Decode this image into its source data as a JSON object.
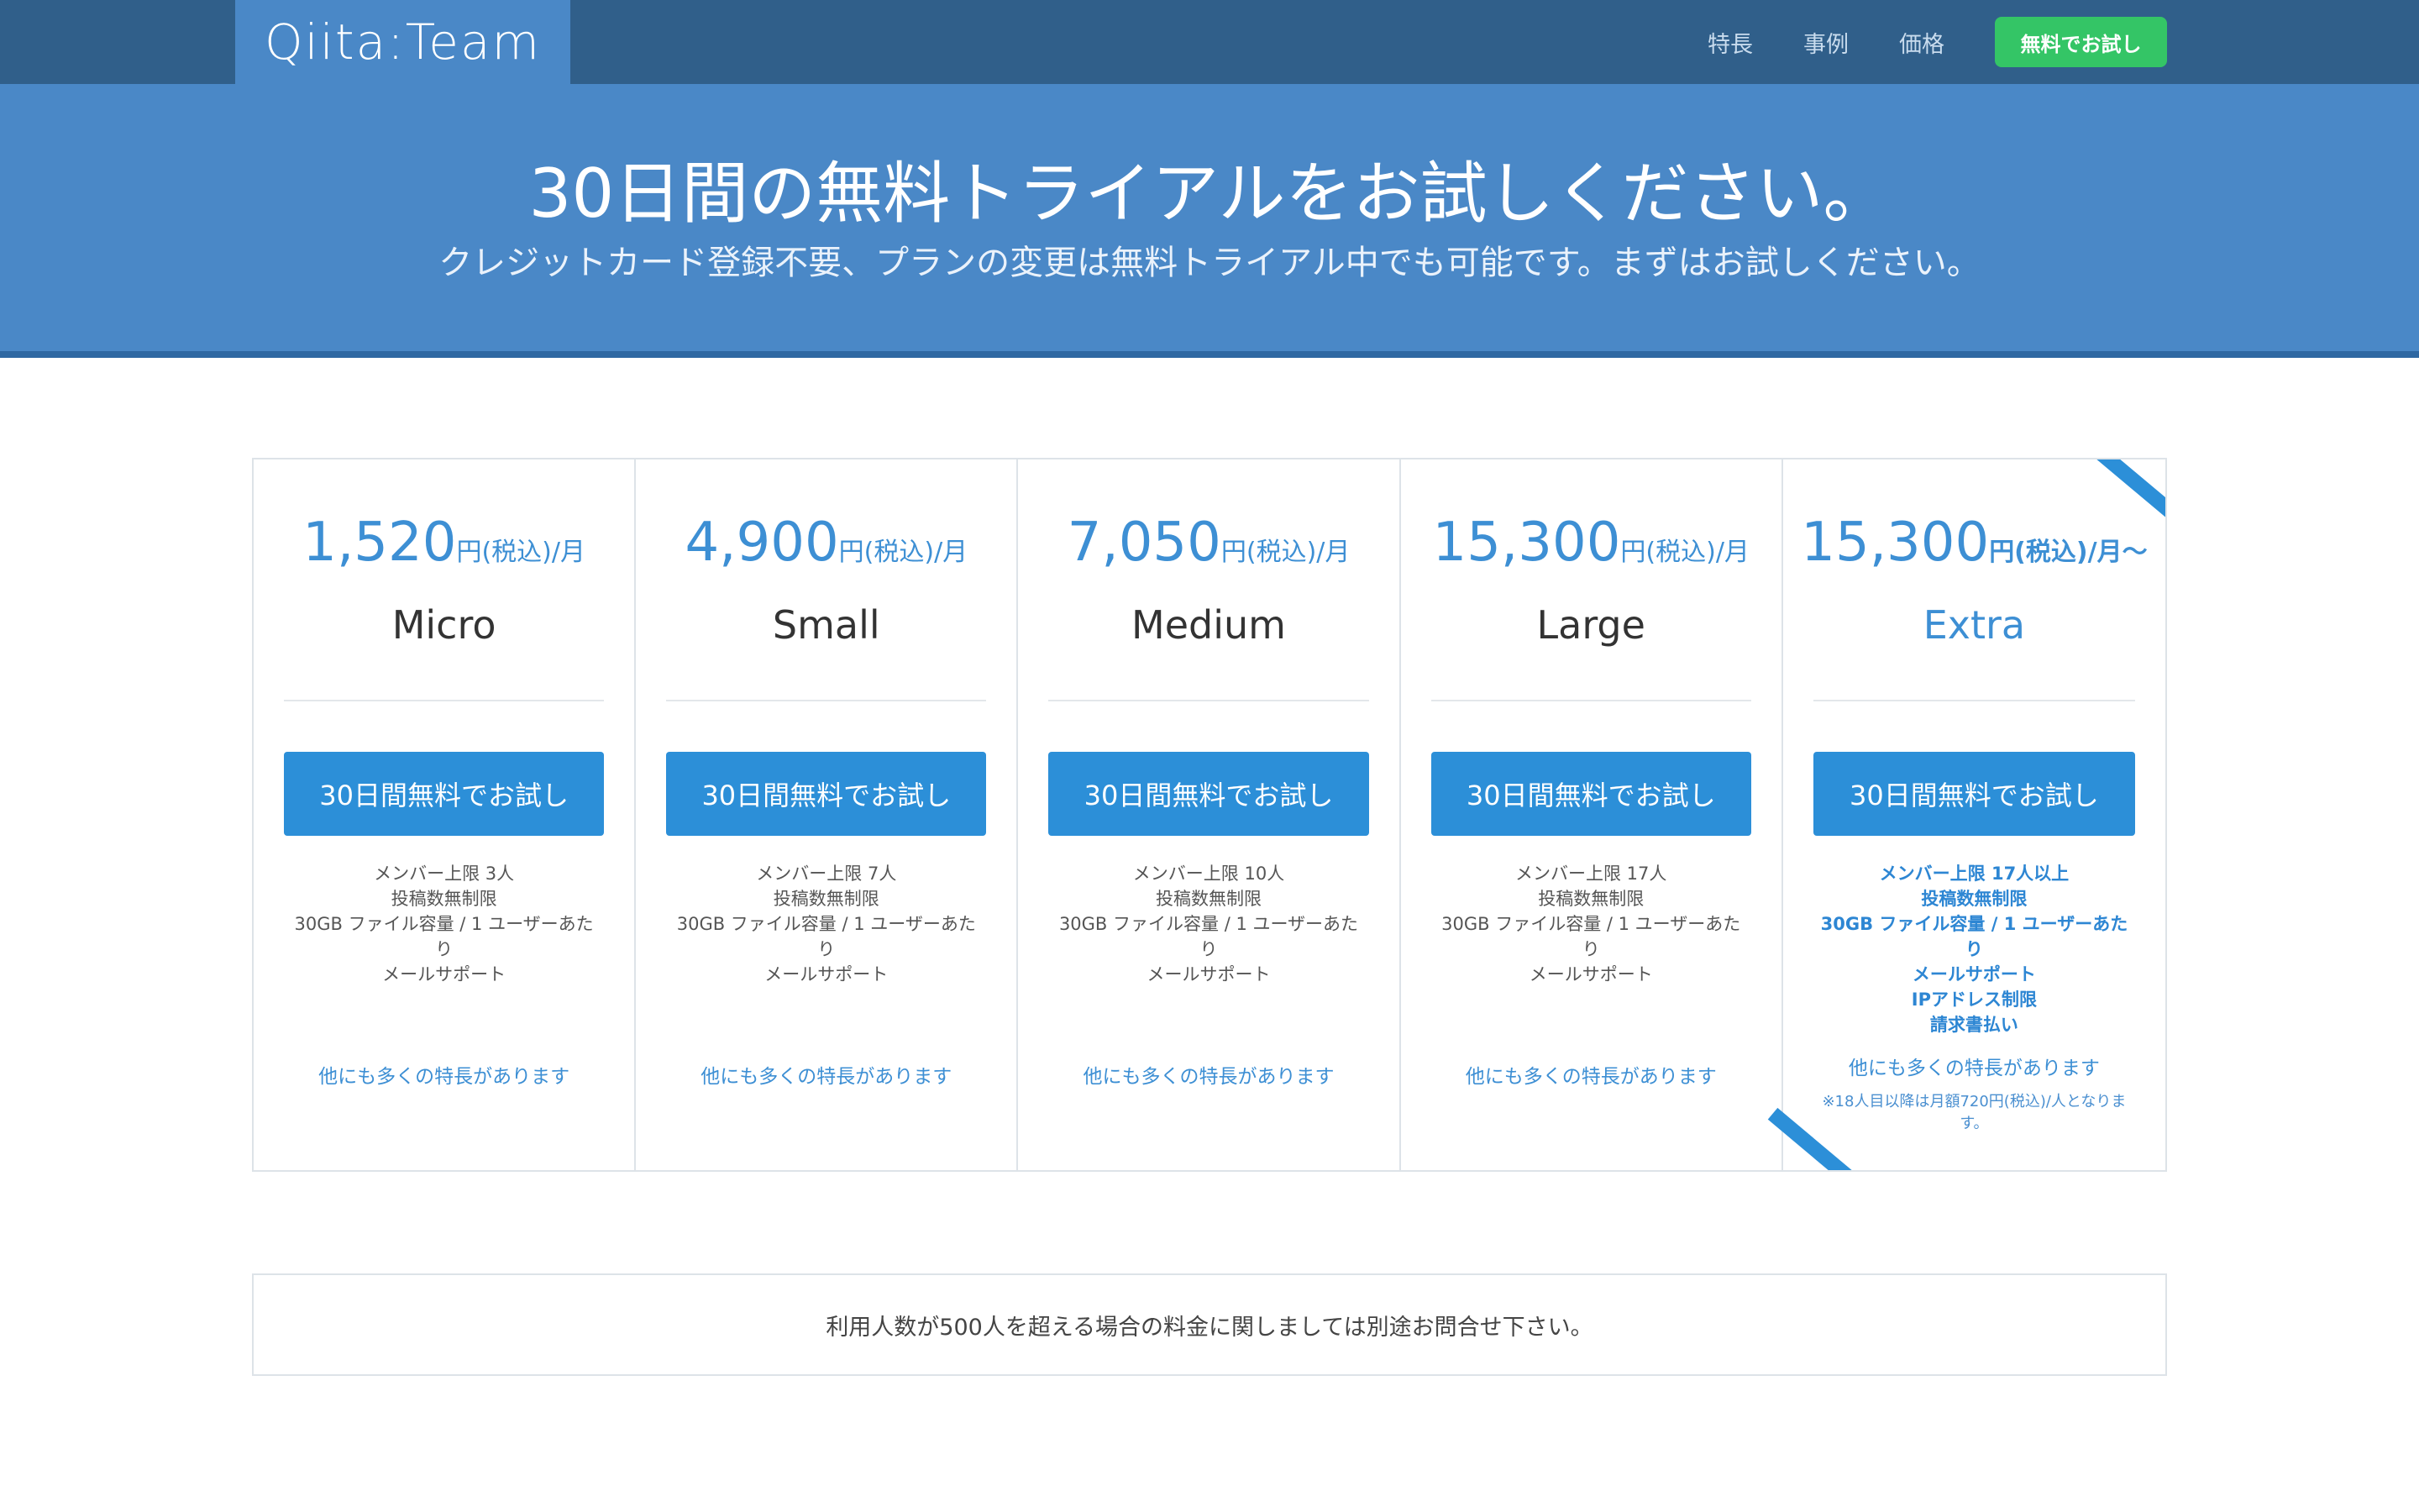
{
  "header": {
    "logo": "Qiita:Team",
    "nav": [
      {
        "label": "特長"
      },
      {
        "label": "事例"
      },
      {
        "label": "価格"
      }
    ],
    "cta_label": "無料でお試し"
  },
  "hero": {
    "title": "30日間の無料トライアルをお試しください。",
    "subtitle": "クレジットカード登録不要、プランの変更は無料トライアル中でも可能です。まずはお試しください。"
  },
  "plans": [
    {
      "price": "1,520",
      "unit": "円(税込)/月",
      "name": "Micro",
      "button": "30日間無料でお試し",
      "features": [
        "メンバー上限 3人",
        "投稿数無制限",
        "30GB ファイル容量 / 1 ユーザーあたり",
        "メールサポート"
      ],
      "more": "他にも多くの特長があります"
    },
    {
      "price": "4,900",
      "unit": "円(税込)/月",
      "name": "Small",
      "button": "30日間無料でお試し",
      "features": [
        "メンバー上限 7人",
        "投稿数無制限",
        "30GB ファイル容量 / 1 ユーザーあたり",
        "メールサポート"
      ],
      "more": "他にも多くの特長があります"
    },
    {
      "price": "7,050",
      "unit": "円(税込)/月",
      "name": "Medium",
      "button": "30日間無料でお試し",
      "features": [
        "メンバー上限 10人",
        "投稿数無制限",
        "30GB ファイル容量 / 1 ユーザーあたり",
        "メールサポート"
      ],
      "more": "他にも多くの特長があります"
    },
    {
      "price": "15,300",
      "unit": "円(税込)/月",
      "name": "Large",
      "button": "30日間無料でお試し",
      "features": [
        "メンバー上限 17人",
        "投稿数無制限",
        "30GB ファイル容量 / 1 ユーザーあたり",
        "メールサポート"
      ],
      "more": "他にも多くの特長があります"
    },
    {
      "price": "15,300",
      "unit": "円(税込)/月〜",
      "name": "Extra",
      "button": "30日間無料でお試し",
      "features": [
        "メンバー上限 17人以上",
        "投稿数無制限",
        "30GB ファイル容量 / 1 ユーザーあたり",
        "メールサポート",
        "IPアドレス制限",
        "請求書払い"
      ],
      "more": "他にも多くの特長があります",
      "note": "※18人目以降は月額720円(税込)/人となります。"
    }
  ],
  "bottom_note": "利用人数が500人を超える場合の料金に関しましては別途お問合せ下さい。",
  "colors": {
    "header_bg": "#305f8a",
    "hero_bg": "#4a88c7",
    "accent": "#2c8fd8",
    "cta_green": "#34c566"
  }
}
